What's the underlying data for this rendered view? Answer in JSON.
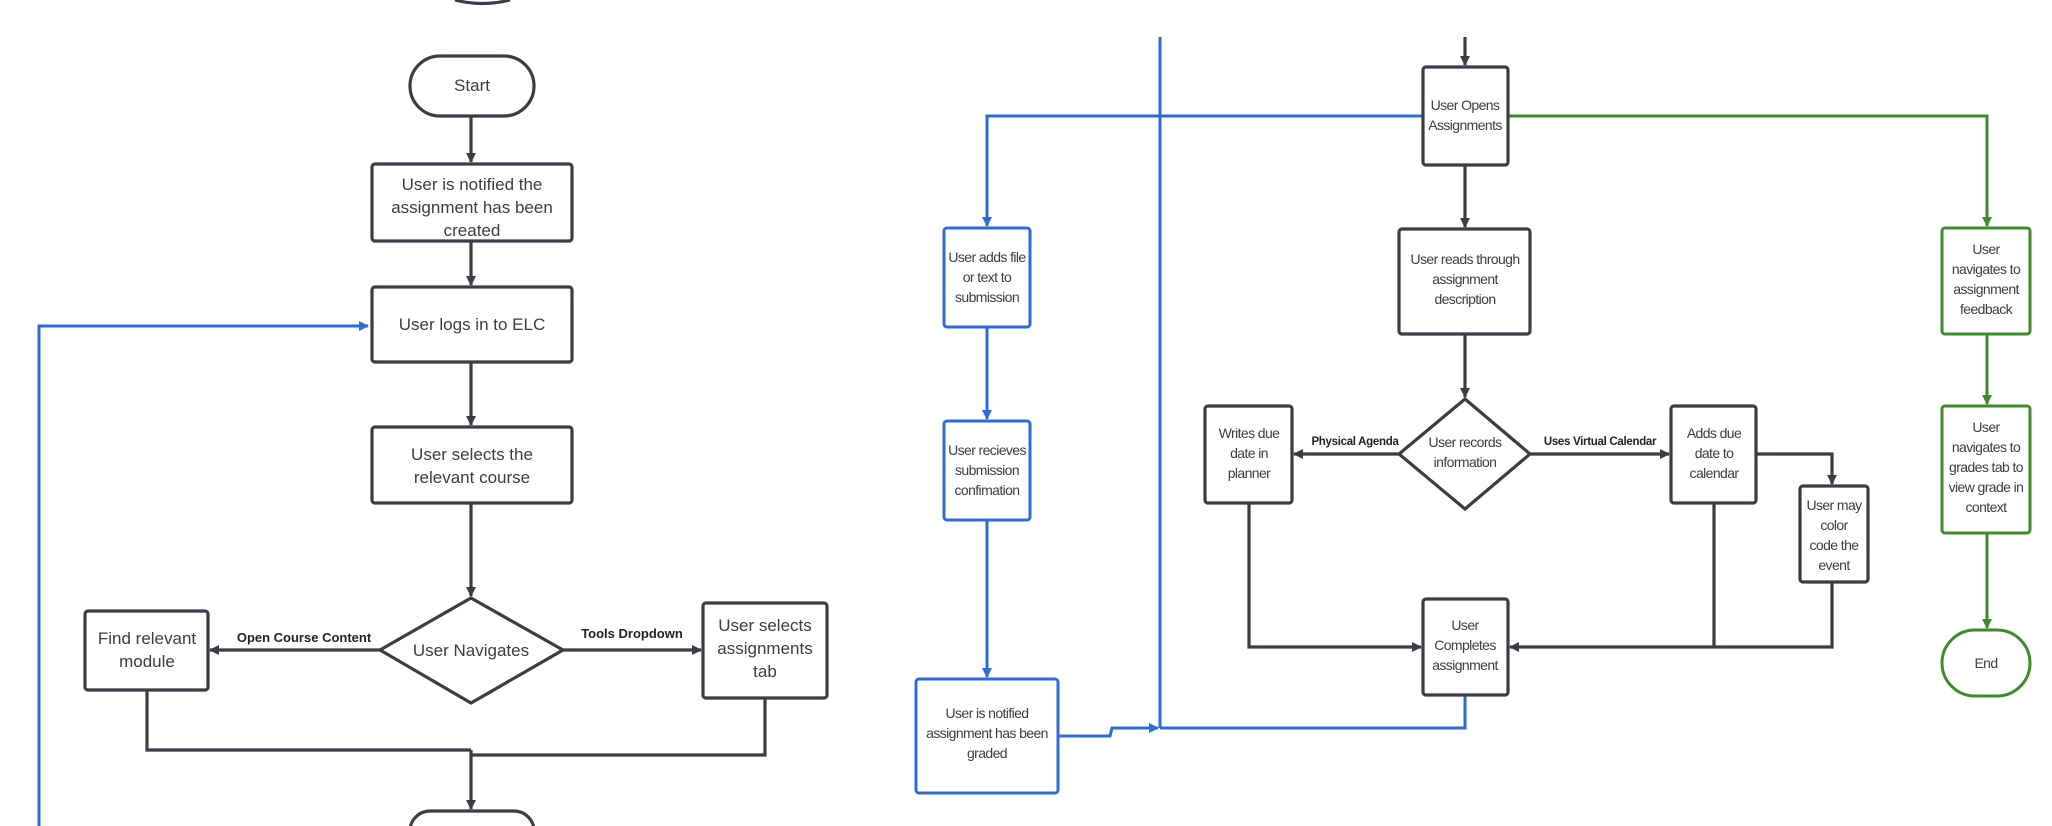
{
  "colors": {
    "main": "#3a3d45",
    "submission_path": "#2f6ad9",
    "feedback_path": "#3d8b2b"
  },
  "nodes": {
    "start": {
      "lines": [
        "Start"
      ]
    },
    "notified_created": {
      "lines": [
        "User is notified the",
        "assignment has been",
        "created"
      ]
    },
    "logs_in": {
      "lines": [
        "User logs in to ELC"
      ]
    },
    "selects_course": {
      "lines": [
        "User selects the",
        "relevant course"
      ]
    },
    "navigates": {
      "lines": [
        "User Navigates"
      ]
    },
    "find_module": {
      "lines": [
        "Find relevant",
        "module"
      ]
    },
    "selects_tab": {
      "lines": [
        "User selects",
        "assignments",
        "tab"
      ]
    },
    "opens_assignments": {
      "lines": [
        "User Opens",
        "Assignments"
      ]
    },
    "adds_file": {
      "lines": [
        "User adds file",
        "or text to",
        "submission"
      ]
    },
    "receives_confirmation": {
      "lines": [
        "User recieves",
        "submission",
        "confimation"
      ]
    },
    "notified_graded": {
      "lines": [
        "User is notified",
        "assignment has been",
        "graded"
      ]
    },
    "reads_description": {
      "lines": [
        "User reads through",
        "assignment",
        "description"
      ]
    },
    "records_info": {
      "lines": [
        "User records",
        "information"
      ]
    },
    "writes_planner": {
      "lines": [
        "Writes due",
        "date in",
        "planner"
      ]
    },
    "adds_calendar": {
      "lines": [
        "Adds due",
        "date to",
        "calendar"
      ]
    },
    "color_code": {
      "lines": [
        "User may",
        "color",
        "code the",
        "event"
      ]
    },
    "completes": {
      "lines": [
        "User",
        "Completes",
        "assignment"
      ]
    },
    "feedback": {
      "lines": [
        "User",
        "navigates to",
        "assignment",
        "feedback"
      ]
    },
    "grades_tab": {
      "lines": [
        "User",
        "navigates to",
        "grades tab to",
        "view grade in",
        "context"
      ]
    },
    "end": {
      "lines": [
        "End"
      ]
    }
  },
  "edge_labels": {
    "open_course_content": "Open Course Content",
    "tools_dropdown": "Tools Dropdown",
    "physical_agenda": "Physical Agenda",
    "uses_virtual_calendar": "Uses Virtual Calendar"
  }
}
